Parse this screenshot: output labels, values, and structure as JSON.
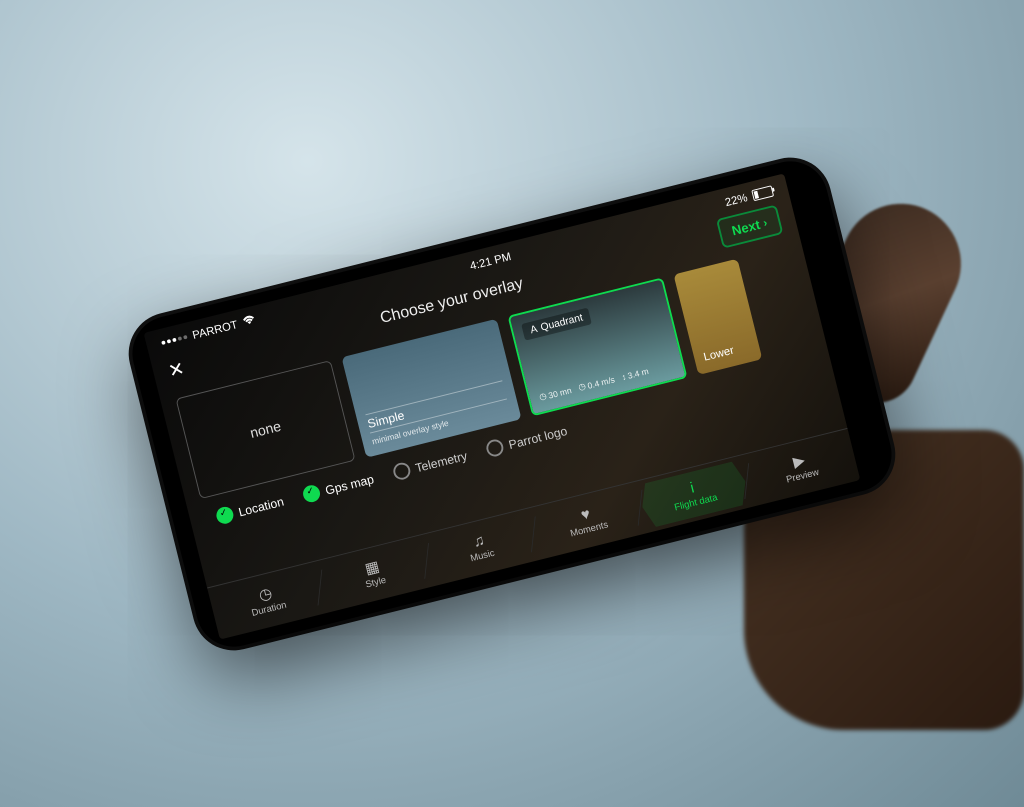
{
  "status": {
    "carrier": "PARROT",
    "time": "4:21 PM",
    "battery_pct": "22%"
  },
  "header": {
    "title": "Choose your overlay",
    "next_label": "Next"
  },
  "overlays": {
    "none_label": "none",
    "simple": {
      "name": "Simple",
      "sub": "minimal overlay style"
    },
    "quadrant": {
      "name": "Quadrant",
      "stat1": "30 mn",
      "stat2": "0.4 m/s",
      "stat3": "3.4 m"
    },
    "lower": {
      "name": "Lower"
    }
  },
  "options": {
    "location": "Location",
    "gps_map": "Gps map",
    "telemetry": "Telemetry",
    "parrot_logo": "Parrot logo"
  },
  "nav": {
    "duration": "Duration",
    "style": "Style",
    "music": "Music",
    "moments": "Moments",
    "flight_data": "Flight data",
    "preview": "Preview"
  }
}
